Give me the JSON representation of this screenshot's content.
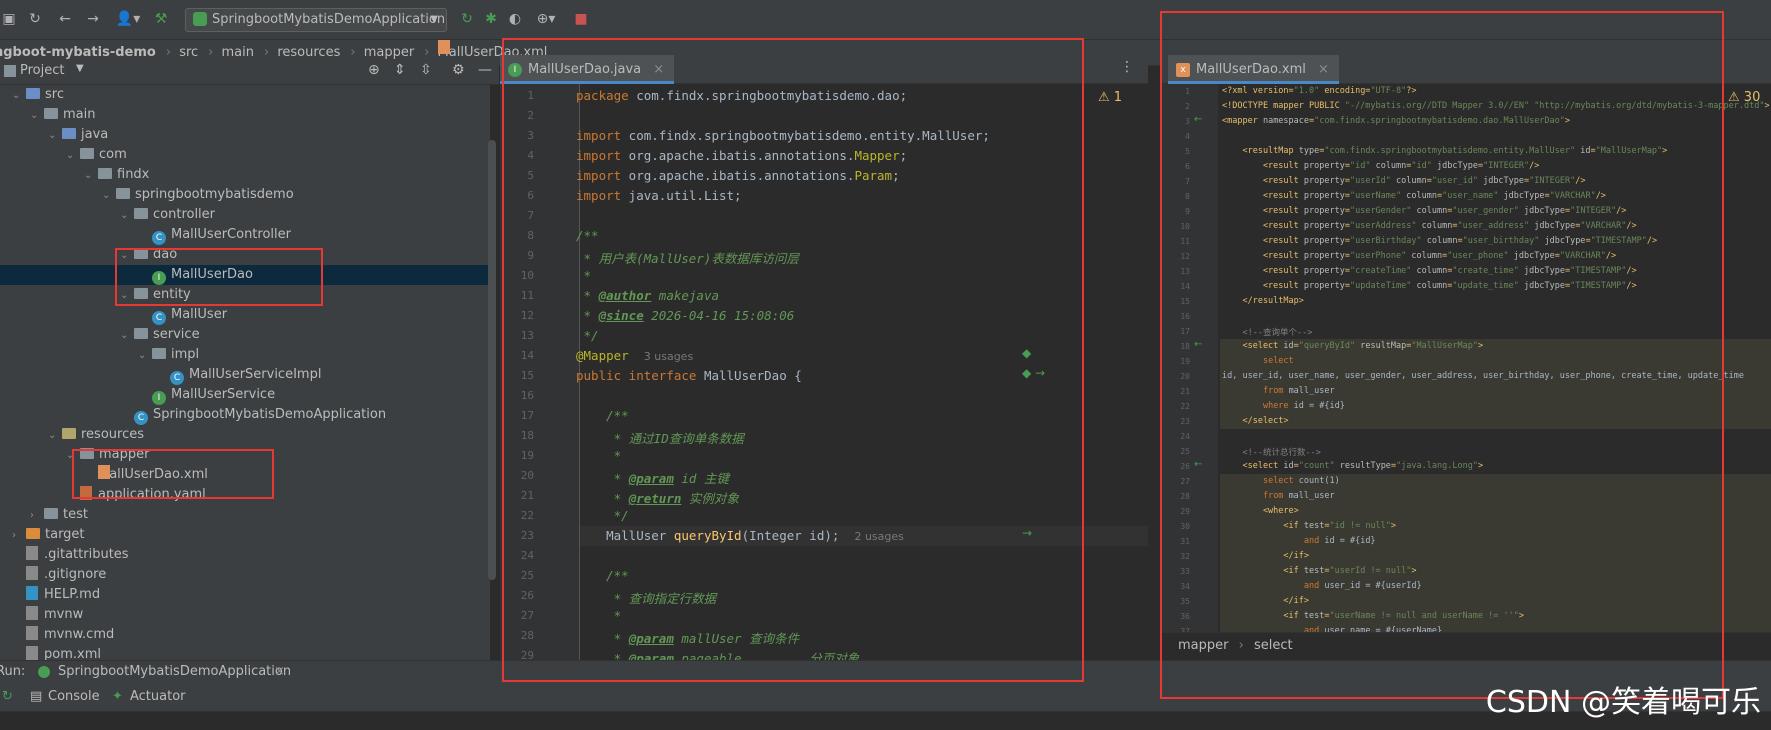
{
  "toolbar": {
    "run_config": "SpringbootMybatisDemoApplication"
  },
  "breadcrumb": [
    "ngboot-mybatis-demo",
    "src",
    "main",
    "resources",
    "mapper",
    "MallUserDao.xml"
  ],
  "project_panel": {
    "title": "Project",
    "tree": [
      {
        "label": "src",
        "depth": 1,
        "kind": "folder-src",
        "open": true
      },
      {
        "label": "main",
        "depth": 2,
        "kind": "folder",
        "open": true
      },
      {
        "label": "java",
        "depth": 3,
        "kind": "folder-src",
        "open": true
      },
      {
        "label": "com",
        "depth": 4,
        "kind": "folder",
        "open": true
      },
      {
        "label": "findx",
        "depth": 5,
        "kind": "folder",
        "open": true
      },
      {
        "label": "springbootmybatisdemo",
        "depth": 6,
        "kind": "folder",
        "open": true
      },
      {
        "label": "controller",
        "depth": 7,
        "kind": "folder",
        "open": true
      },
      {
        "label": "MallUserController",
        "depth": 8,
        "kind": "class"
      },
      {
        "label": "dao",
        "depth": 7,
        "kind": "folder",
        "open": true
      },
      {
        "label": "MallUserDao",
        "depth": 8,
        "kind": "interface",
        "selected": true
      },
      {
        "label": "entity",
        "depth": 7,
        "kind": "folder",
        "open": true
      },
      {
        "label": "MallUser",
        "depth": 8,
        "kind": "class"
      },
      {
        "label": "service",
        "depth": 7,
        "kind": "folder",
        "open": true
      },
      {
        "label": "impl",
        "depth": 8,
        "kind": "folder",
        "open": true
      },
      {
        "label": "MallUserServiceImpl",
        "depth": 9,
        "kind": "class"
      },
      {
        "label": "MallUserService",
        "depth": 8,
        "kind": "interface"
      },
      {
        "label": "SpringbootMybatisDemoApplication",
        "depth": 7,
        "kind": "class"
      },
      {
        "label": "resources",
        "depth": 3,
        "kind": "folder-res",
        "open": true
      },
      {
        "label": "mapper",
        "depth": 4,
        "kind": "folder",
        "open": true
      },
      {
        "label": "MallUserDao.xml",
        "depth": 5,
        "kind": "xml"
      },
      {
        "label": "application.yaml",
        "depth": 4,
        "kind": "yaml"
      },
      {
        "label": "test",
        "depth": 2,
        "kind": "folder",
        "open": false
      },
      {
        "label": "target",
        "depth": 1,
        "kind": "folder-excl",
        "open": false
      },
      {
        "label": ".gitattributes",
        "depth": 1,
        "kind": "file"
      },
      {
        "label": ".gitignore",
        "depth": 1,
        "kind": "file"
      },
      {
        "label": "HELP.md",
        "depth": 1,
        "kind": "md"
      },
      {
        "label": "mvnw",
        "depth": 1,
        "kind": "file"
      },
      {
        "label": "mvnw.cmd",
        "depth": 1,
        "kind": "file"
      },
      {
        "label": "pom.xml",
        "depth": 1,
        "kind": "file"
      }
    ]
  },
  "editor_java": {
    "tab": "MallUserDao.java",
    "warnings": "1",
    "lines": [
      {
        "n": "1",
        "h": "<span class='kw'>package</span> com.findx.springbootmybatisdemo.dao;"
      },
      {
        "n": "2",
        "h": ""
      },
      {
        "n": "3",
        "h": "<span class='kw'>import</span> com.findx.springbootmybatisdemo.entity.MallUser;"
      },
      {
        "n": "4",
        "h": "<span class='kw'>import</span> org.apache.ibatis.annotations.<span class='ann'>Mapper</span>;"
      },
      {
        "n": "5",
        "h": "<span class='kw'>import</span> org.apache.ibatis.annotations.<span class='ann'>Param</span>;"
      },
      {
        "n": "6",
        "h": "<span class='kw'>import</span> java.util.List;"
      },
      {
        "n": "7",
        "h": ""
      },
      {
        "n": "8",
        "h": "<span class='cm'>/**</span>"
      },
      {
        "n": "9",
        "h": "<span class='cm'> * 用户表(MallUser)表数据库访问层</span>"
      },
      {
        "n": "10",
        "h": "<span class='cm'> *</span>"
      },
      {
        "n": "11",
        "h": "<span class='cm'> * <b><u>@author</u></b> makejava</span>"
      },
      {
        "n": "12",
        "h": "<span class='cm'> * <b><u>@since</u></b> 2026-04-16 15:08:06</span>"
      },
      {
        "n": "13",
        "h": "<span class='cm'> */</span>"
      },
      {
        "n": "14",
        "h": "<span class='ann'>@Mapper</span>  <span class='hint'>3 usages</span>"
      },
      {
        "n": "15",
        "h": "<span class='kw'>public interface</span> MallUserDao {"
      },
      {
        "n": "16",
        "h": ""
      },
      {
        "n": "17",
        "h": "    <span class='cm'>/**</span>"
      },
      {
        "n": "18",
        "h": "<span class='cm'>     * 通过ID查询单条数据</span>"
      },
      {
        "n": "19",
        "h": "<span class='cm'>     *</span>"
      },
      {
        "n": "20",
        "h": "<span class='cm'>     * <b><u>@param</u></b> id 主键</span>"
      },
      {
        "n": "21",
        "h": "<span class='cm'>     * <b><u>@return</u></b> 实例对象</span>"
      },
      {
        "n": "22",
        "h": "<span class='cm'>     */</span>"
      },
      {
        "n": "23",
        "h": "    MallUser <span class='fn'>queryById</span>(Integer id);  <span class='hint'>2 usages</span>"
      },
      {
        "n": "24",
        "h": ""
      },
      {
        "n": "25",
        "h": "    <span class='cm'>/**</span>"
      },
      {
        "n": "26",
        "h": "<span class='cm'>     * 查询指定行数据</span>"
      },
      {
        "n": "27",
        "h": "<span class='cm'>     *</span>"
      },
      {
        "n": "28",
        "h": "<span class='cm'>     * <b><u>@param</u></b> mallUser 查询条件</span>"
      },
      {
        "n": "29",
        "h": "<span class='cm'>     * <b><u>@param</u></b> pageable         分页对象</span>"
      }
    ]
  },
  "editor_xml": {
    "tab": "MallUserDao.xml",
    "warnings": "30",
    "crumb": [
      "mapper",
      "select"
    ],
    "lines": [
      {
        "n": "1",
        "h": "&lt;?xml version=<span class='x-val'>\"1.0\"</span> encoding=<span class='x-val'>\"UTF-8\"</span>?&gt;"
      },
      {
        "n": "2",
        "h": "&lt;!DOCTYPE mapper PUBLIC <span class='x-val'>\"-//mybatis.org//DTD Mapper 3.0//EN\"</span> <span class='x-val'>\"http://mybatis.org/dtd/mybatis-3-mapper.dtd\"</span>&gt;"
      },
      {
        "n": "3",
        "h": "&lt;mapper <span class='x-attr'>namespace</span>=<span class='x-val'>\"com.findx.springbootmybatisdemo.dao.MallUserDao\"</span>&gt;"
      },
      {
        "n": "4",
        "h": ""
      },
      {
        "n": "5",
        "h": "    &lt;resultMap <span class='x-attr'>type</span>=<span class='x-val'>\"com.findx.springbootmybatisdemo.entity.MallUser\"</span> <span class='x-attr'>id</span>=<span class='x-val'>\"MallUserMap\"</span>&gt;"
      },
      {
        "n": "6",
        "h": "        &lt;result <span class='x-attr'>property</span>=<span class='x-val'>\"id\"</span> <span class='x-attr'>column</span>=<span class='x-val'>\"id\"</span> <span class='x-attr'>jdbcType</span>=<span class='x-val'>\"INTEGER\"</span>/&gt;"
      },
      {
        "n": "7",
        "h": "        &lt;result <span class='x-attr'>property</span>=<span class='x-val'>\"userId\"</span> <span class='x-attr'>column</span>=<span class='x-val'>\"user_id\"</span> <span class='x-attr'>jdbcType</span>=<span class='x-val'>\"INTEGER\"</span>/&gt;"
      },
      {
        "n": "8",
        "h": "        &lt;result <span class='x-attr'>property</span>=<span class='x-val'>\"userName\"</span> <span class='x-attr'>column</span>=<span class='x-val'>\"user_name\"</span> <span class='x-attr'>jdbcType</span>=<span class='x-val'>\"VARCHAR\"</span>/&gt;"
      },
      {
        "n": "9",
        "h": "        &lt;result <span class='x-attr'>property</span>=<span class='x-val'>\"userGender\"</span> <span class='x-attr'>column</span>=<span class='x-val'>\"user_gender\"</span> <span class='x-attr'>jdbcType</span>=<span class='x-val'>\"INTEGER\"</span>/&gt;"
      },
      {
        "n": "10",
        "h": "        &lt;result <span class='x-attr'>property</span>=<span class='x-val'>\"userAddress\"</span> <span class='x-attr'>column</span>=<span class='x-val'>\"user_address\"</span> <span class='x-attr'>jdbcType</span>=<span class='x-val'>\"VARCHAR\"</span>/&gt;"
      },
      {
        "n": "11",
        "h": "        &lt;result <span class='x-attr'>property</span>=<span class='x-val'>\"userBirthday\"</span> <span class='x-attr'>column</span>=<span class='x-val'>\"user_birthday\"</span> <span class='x-attr'>jdbcType</span>=<span class='x-val'>\"TIMESTAMP\"</span>/&gt;"
      },
      {
        "n": "12",
        "h": "        &lt;result <span class='x-attr'>property</span>=<span class='x-val'>\"userPhone\"</span> <span class='x-attr'>column</span>=<span class='x-val'>\"user_phone\"</span> <span class='x-attr'>jdbcType</span>=<span class='x-val'>\"VARCHAR\"</span>/&gt;"
      },
      {
        "n": "13",
        "h": "        &lt;result <span class='x-attr'>property</span>=<span class='x-val'>\"createTime\"</span> <span class='x-attr'>column</span>=<span class='x-val'>\"create_time\"</span> <span class='x-attr'>jdbcType</span>=<span class='x-val'>\"TIMESTAMP\"</span>/&gt;"
      },
      {
        "n": "14",
        "h": "        &lt;result <span class='x-attr'>property</span>=<span class='x-val'>\"updateTime\"</span> <span class='x-attr'>column</span>=<span class='x-val'>\"update_time\"</span> <span class='x-attr'>jdbcType</span>=<span class='x-val'>\"TIMESTAMP\"</span>/&gt;"
      },
      {
        "n": "15",
        "h": "    &lt;/resultMap&gt;"
      },
      {
        "n": "16",
        "h": ""
      },
      {
        "n": "17",
        "h": "    <span class='x-cm'>&lt;!--查询单个--&gt;</span>"
      },
      {
        "n": "18",
        "h": "    &lt;select <span class='x-attr'>id</span>=<span class='x-val'>\"queryById\"</span> <span class='x-attr'>resultMap</span>=<span class='x-val'>\"MallUserMap\"</span>&gt;",
        "hl": true
      },
      {
        "n": "19",
        "h": "        <span class='x-kw'>select</span>",
        "hl": true
      },
      {
        "n": "20",
        "h": "<span class='x-txt'>id, user_id, user_name, user_gender, user_address, user_birthday, user_phone, create_time, update_time</span>",
        "hl": true
      },
      {
        "n": "21",
        "h": "        <span class='x-kw'>from</span> <span class='x-txt'>mall_user</span>",
        "hl": true
      },
      {
        "n": "22",
        "h": "        <span class='x-kw'>where</span> <span class='x-txt'>id = #{id}</span>",
        "hl": true
      },
      {
        "n": "23",
        "h": "    &lt;/select&gt;",
        "hl": true
      },
      {
        "n": "24",
        "h": ""
      },
      {
        "n": "25",
        "h": "    <span class='x-cm'>&lt;!--统计总行数--&gt;</span>"
      },
      {
        "n": "26",
        "h": "    &lt;select <span class='x-attr'>id</span>=<span class='x-val'>\"count\"</span> <span class='x-attr'>resultType</span>=<span class='x-val'>\"java.lang.Long\"</span>&gt;"
      },
      {
        "n": "27",
        "h": "        <span class='x-kw'>select</span> <span class='x-txt'>count(1)</span>",
        "hl": true
      },
      {
        "n": "28",
        "h": "        <span class='x-kw'>from</span> <span class='x-txt'>mall_user</span>",
        "hl": true
      },
      {
        "n": "29",
        "h": "        &lt;where&gt;",
        "hl": true
      },
      {
        "n": "30",
        "h": "            &lt;if <span class='x-attr'>test</span>=<span class='x-val'>\"id != null\"</span>&gt;",
        "hl": true
      },
      {
        "n": "31",
        "h": "                <span class='x-kw'>and</span> <span class='x-txt'>id = #{id}</span>",
        "hl": true
      },
      {
        "n": "32",
        "h": "            &lt;/if&gt;",
        "hl": true
      },
      {
        "n": "33",
        "h": "            &lt;if <span class='x-attr'>test</span>=<span class='x-val'>\"userId != null\"</span>&gt;",
        "hl": true
      },
      {
        "n": "34",
        "h": "                <span class='x-kw'>and</span> <span class='x-txt'>user_id = #{userId}</span>",
        "hl": true
      },
      {
        "n": "35",
        "h": "            &lt;/if&gt;",
        "hl": true
      },
      {
        "n": "36",
        "h": "            &lt;if <span class='x-attr'>test</span>=<span class='x-val'>\"userName != null and userName != ''\"</span>&gt;",
        "hl": true
      },
      {
        "n": "37",
        "h": "                <span class='x-kw'>and</span> <span class='x-txt'>user_name = #{userName}</span>",
        "hl": true
      }
    ]
  },
  "run_panel": {
    "label": "Run:",
    "config_tab": "SpringbootMybatisDemoApplication",
    "tabs": [
      "Console",
      "Actuator"
    ]
  },
  "watermark": "CSDN @笑着喝可乐"
}
